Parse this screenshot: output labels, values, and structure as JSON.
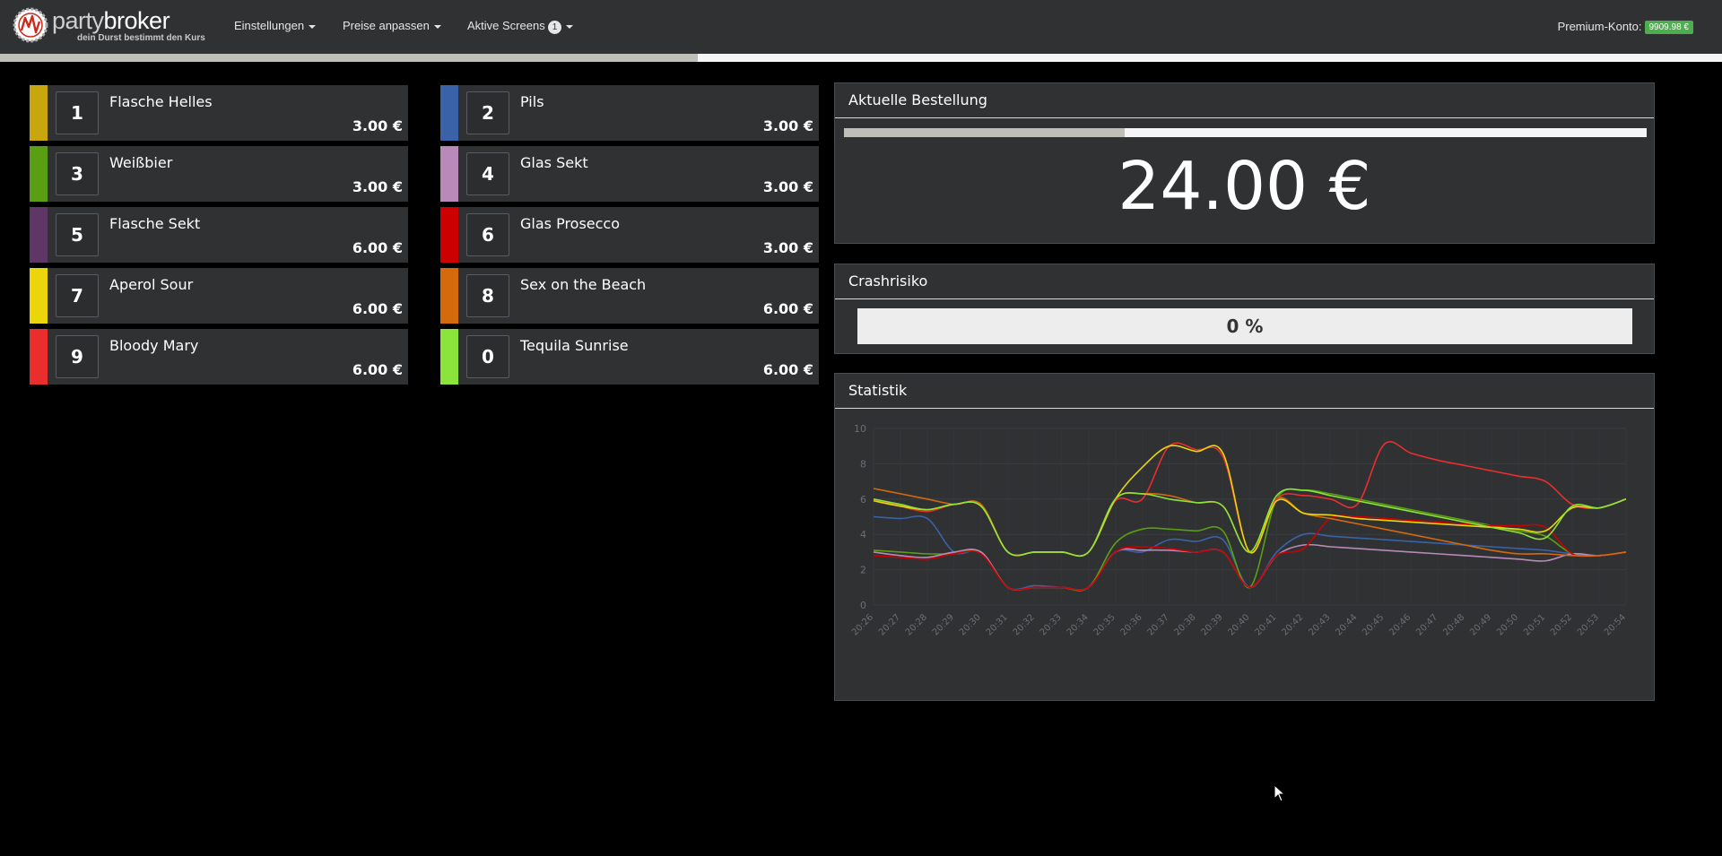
{
  "nav": {
    "brand_name_1": "party",
    "brand_name_2": "broker",
    "tagline": "dein Durst bestimmt den Kurs",
    "menu": [
      {
        "label": "Einstellungen"
      },
      {
        "label": "Preise anpassen"
      },
      {
        "label": "Aktive Screens",
        "badge": "1"
      }
    ],
    "premium_label": "Premium-Konto:",
    "premium_value": "9909.98 €",
    "progress": 0.405
  },
  "products": [
    {
      "key": "1",
      "name": "Flasche Helles",
      "price": "3.00 €",
      "color": "#c8a70e"
    },
    {
      "key": "2",
      "name": "Pils",
      "price": "3.00 €",
      "color": "#3a62a8"
    },
    {
      "key": "3",
      "name": "Weißbier",
      "price": "3.00 €",
      "color": "#5a9e13"
    },
    {
      "key": "4",
      "name": "Glas Sekt",
      "price": "3.00 €",
      "color": "#b98ab9"
    },
    {
      "key": "5",
      "name": "Flasche Sekt",
      "price": "6.00 €",
      "color": "#5e3766"
    },
    {
      "key": "6",
      "name": "Glas Prosecco",
      "price": "3.00 €",
      "color": "#cc0000"
    },
    {
      "key": "7",
      "name": "Aperol Sour",
      "price": "6.00 €",
      "color": "#ead60b"
    },
    {
      "key": "8",
      "name": "Sex on the Beach",
      "price": "6.00 €",
      "color": "#d46a0c"
    },
    {
      "key": "9",
      "name": "Bloody Mary",
      "price": "6.00 €",
      "color": "#ea2e2e"
    },
    {
      "key": "0",
      "name": "Tequila Sunrise",
      "price": "6.00 €",
      "color": "#8be43c"
    }
  ],
  "order": {
    "title": "Aktuelle Bestellung",
    "total": "24.00 €",
    "progress": 0.35
  },
  "crash": {
    "title": "Crashrisiko",
    "value": "0 %",
    "percent": 0
  },
  "stats": {
    "title": "Statistik"
  },
  "chart_data": {
    "type": "line",
    "x": [
      "20:26",
      "20:27",
      "20:28",
      "20:29",
      "20:30",
      "20:31",
      "20:32",
      "20:33",
      "20:34",
      "20:35",
      "20:36",
      "20:37",
      "20:38",
      "20:39",
      "20:40",
      "20:41",
      "20:42",
      "20:43",
      "20:44",
      "20:45",
      "20:46",
      "20:47",
      "20:48",
      "20:49",
      "20:50",
      "20:51",
      "20:52",
      "20:53",
      "20:54"
    ],
    "ylim": [
      0,
      10
    ],
    "yticks": [
      0,
      2,
      4,
      6,
      8,
      10
    ],
    "grid": true,
    "series": [
      {
        "color": "#3a62a8",
        "values": [
          5.0,
          4.9,
          4.9,
          3.0,
          3.0,
          1.0,
          1.1,
          1.0,
          1.0,
          3.0,
          3.0,
          3.7,
          3.6,
          3.7,
          1.0,
          3.0,
          4.0,
          3.9,
          3.8,
          3.7,
          3.6,
          3.5,
          3.4,
          3.3,
          3.2,
          3.1,
          2.9,
          2.8,
          3.0
        ]
      },
      {
        "color": "#5a9e13",
        "values": [
          3.1,
          3.0,
          2.9,
          2.9,
          3.0,
          1.0,
          1.0,
          1.0,
          1.0,
          3.5,
          4.3,
          4.3,
          4.2,
          4.2,
          1.0,
          6.0,
          6.5,
          6.3,
          6.0,
          5.7,
          5.4,
          5.1,
          4.8,
          4.5,
          4.2,
          3.9,
          2.9,
          2.8,
          3.0
        ]
      },
      {
        "color": "#b98ab9",
        "values": [
          3.0,
          2.8,
          2.7,
          3.0,
          3.0,
          1.0,
          1.0,
          1.0,
          1.0,
          3.0,
          3.1,
          3.1,
          3.0,
          3.0,
          1.0,
          2.8,
          3.4,
          3.3,
          3.2,
          3.1,
          3.0,
          2.9,
          2.8,
          2.7,
          2.6,
          2.5,
          2.9,
          2.8,
          3.0
        ]
      },
      {
        "color": "#cc0000",
        "values": [
          2.8,
          2.7,
          2.6,
          2.9,
          2.9,
          1.0,
          1.0,
          1.0,
          1.0,
          3.0,
          3.3,
          3.2,
          3.0,
          3.0,
          1.0,
          2.8,
          3.2,
          4.9,
          5.0,
          4.9,
          4.8,
          4.7,
          4.6,
          4.5,
          4.5,
          4.4,
          2.9,
          2.8,
          3.0
        ]
      },
      {
        "color": "#d46a0c",
        "values": [
          6.6,
          6.3,
          6.0,
          5.7,
          5.7,
          3.0,
          3.0,
          3.0,
          3.0,
          6.0,
          6.3,
          6.2,
          5.8,
          5.6,
          3.0,
          6.0,
          5.2,
          4.9,
          4.6,
          4.3,
          4.0,
          3.7,
          3.4,
          3.1,
          2.9,
          2.9,
          2.8,
          2.8,
          3.0
        ]
      },
      {
        "color": "#ea2e2e",
        "values": [
          6.0,
          5.6,
          5.3,
          5.7,
          5.6,
          3.0,
          3.0,
          3.0,
          3.0,
          5.9,
          6.0,
          9.0,
          8.8,
          8.4,
          3.0,
          6.0,
          6.2,
          6.0,
          5.7,
          9.1,
          8.6,
          8.2,
          7.9,
          7.6,
          7.3,
          7.0,
          5.7,
          5.5,
          6.0
        ]
      },
      {
        "color": "#ead60b",
        "values": [
          5.9,
          5.6,
          5.4,
          5.7,
          5.6,
          3.0,
          3.0,
          3.0,
          3.0,
          6.0,
          7.8,
          9.0,
          8.7,
          8.6,
          3.0,
          5.9,
          5.2,
          5.1,
          4.9,
          4.8,
          4.7,
          4.6,
          4.5,
          4.4,
          4.3,
          4.2,
          5.5,
          5.5,
          6.0
        ]
      },
      {
        "color": "#8be43c",
        "values": [
          6.0,
          5.7,
          5.4,
          5.7,
          5.6,
          3.0,
          3.0,
          3.0,
          3.0,
          6.0,
          6.3,
          6.0,
          5.8,
          5.6,
          3.0,
          6.2,
          6.5,
          6.2,
          5.9,
          5.6,
          5.3,
          5.0,
          4.7,
          4.4,
          4.1,
          3.8,
          5.6,
          5.5,
          6.0
        ]
      }
    ]
  }
}
